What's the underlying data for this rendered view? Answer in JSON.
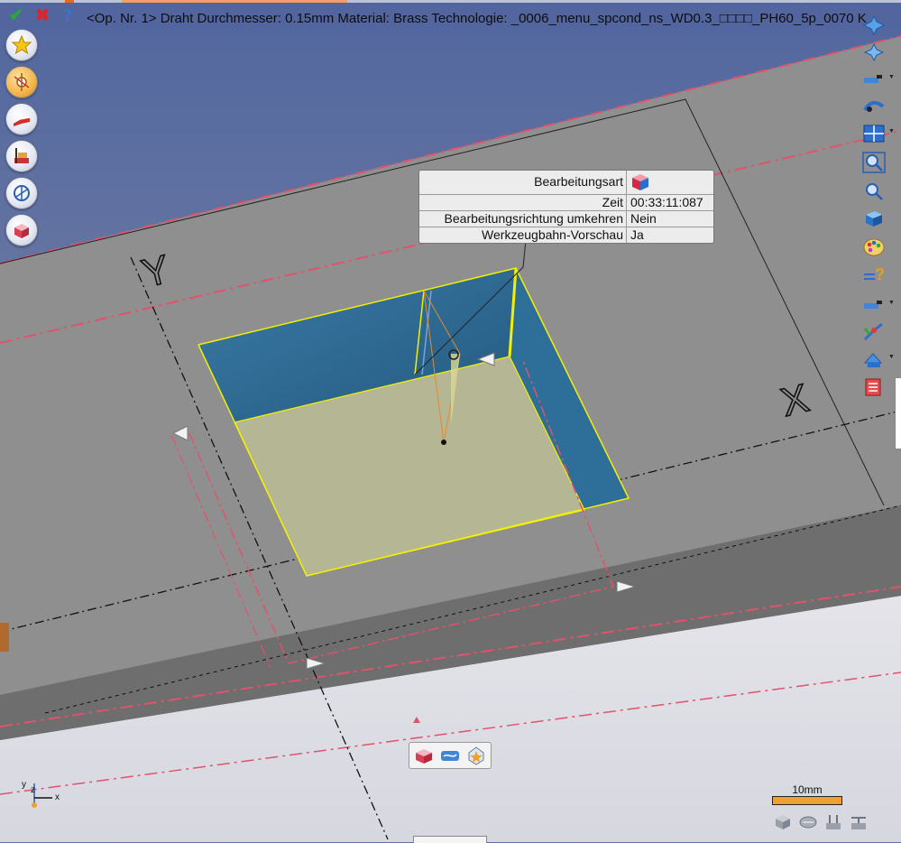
{
  "toolbar": {
    "confirm_icon": "check-icon",
    "cancel_icon": "close-icon",
    "help_icon": "help-icon",
    "operation_title": "<Op. Nr. 1> Draht Durchmesser: 0.15mm Material: Brass Technologie: _0006_menu_spcond_ns_WD0.3_□□□□_PH60_5p_0070 K"
  },
  "left_toolbar": [
    {
      "name": "favorites-star-icon"
    },
    {
      "name": "wire-settings-icon"
    },
    {
      "name": "wire-path-icon"
    },
    {
      "name": "machine-setup-icon"
    },
    {
      "name": "axis-rotation-icon"
    },
    {
      "name": "part-box-icon"
    }
  ],
  "right_toolbar": [
    {
      "name": "move-plane-icon"
    },
    {
      "name": "move-axis-icon"
    },
    {
      "name": "wire-cut-icon",
      "dropdown": true
    },
    {
      "name": "path-preview-icon"
    },
    {
      "name": "view-split-icon",
      "dropdown": true
    },
    {
      "name": "zoom-window-icon"
    },
    {
      "name": "zoom-icon"
    },
    {
      "name": "3d-view-icon"
    },
    {
      "name": "color-palette-icon"
    },
    {
      "name": "query-icon"
    },
    {
      "name": "wire-tool-icon",
      "dropdown": true
    },
    {
      "name": "path-edit-icon"
    },
    {
      "name": "layer-icon",
      "dropdown": true
    },
    {
      "name": "report-icon"
    }
  ],
  "info_panel": {
    "rows": [
      {
        "key": "Bearbeitungsart",
        "value": ""
      },
      {
        "key": "Zeit",
        "value": "00:33:11:087"
      },
      {
        "key": "Bearbeitungsrichtung umkehren",
        "value": "Nein"
      },
      {
        "key": "Werkzeugbahn-Vorschau",
        "value": "Ja"
      }
    ]
  },
  "axis_labels": {
    "y": "Y",
    "x": "X"
  },
  "axis_indicator": {
    "y": "y",
    "z": "z",
    "x": "x"
  },
  "scale": {
    "label": "10mm"
  },
  "mini_toolbar": [
    {
      "name": "part-view-icon"
    },
    {
      "name": "wire-view-icon"
    },
    {
      "name": "snap-point-icon"
    }
  ],
  "bottom_icons": [
    {
      "name": "view-front-icon"
    },
    {
      "name": "view-iso-icon"
    },
    {
      "name": "view-top-icon"
    },
    {
      "name": "view-side-icon"
    }
  ],
  "colors": {
    "sky_top": "#5a6fa6",
    "sky_bottom": "#7f88a8",
    "plate": "#8e8e8e",
    "plate_dark": "#6c6c6c",
    "floor": "#dcdde4",
    "pocket_wall": "#2f6b92",
    "pocket_floor": "#b4b594",
    "dash_red": "#e0536b",
    "edge_yellow": "#f3f000"
  }
}
